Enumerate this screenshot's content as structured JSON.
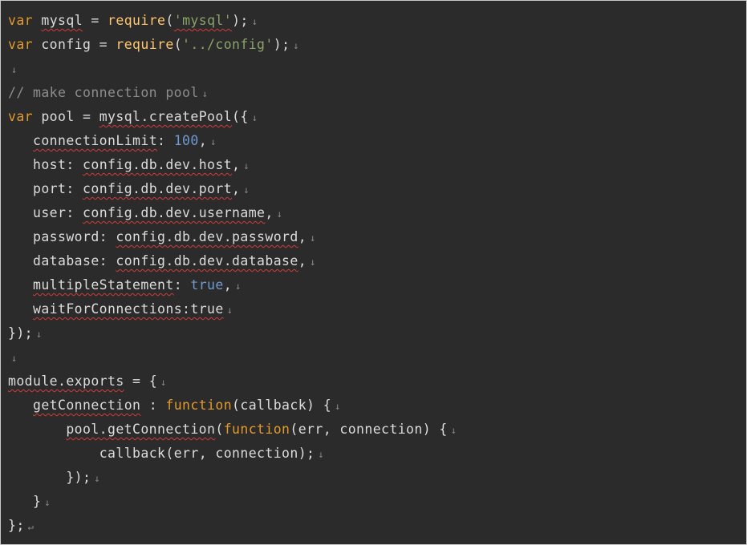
{
  "editor": {
    "colors": {
      "background": "#2b2b2b",
      "text": "#dcdcdc",
      "keyword": "#e39a2d",
      "string": "#8ba36a",
      "number": "#6f9bd1",
      "comment": "#8c8c8c",
      "function_call": "#ffc66d",
      "spellcheck_underline": "#d23b3b",
      "eol_marker": "#8a8a8a"
    },
    "lines": [
      {
        "indent": 0,
        "eol": "↓",
        "tokens": [
          {
            "t": "var",
            "c": "keyword"
          },
          {
            "t": " "
          },
          {
            "t": "mysql",
            "c": "ident",
            "u": true
          },
          {
            "t": " = "
          },
          {
            "t": "require",
            "c": "call"
          },
          {
            "t": "("
          },
          {
            "t": "'mysql'",
            "c": "string",
            "u": true
          },
          {
            "t": ");"
          }
        ]
      },
      {
        "indent": 0,
        "eol": "↓",
        "tokens": [
          {
            "t": "var",
            "c": "keyword"
          },
          {
            "t": " config = "
          },
          {
            "t": "require",
            "c": "call"
          },
          {
            "t": "("
          },
          {
            "t": "'../config'",
            "c": "string"
          },
          {
            "t": ");"
          }
        ]
      },
      {
        "indent": 0,
        "eol": "↓",
        "tokens": []
      },
      {
        "indent": 0,
        "eol": "↓",
        "tokens": [
          {
            "t": "// make connection pool",
            "c": "comment"
          }
        ]
      },
      {
        "indent": 0,
        "eol": "↓",
        "tokens": [
          {
            "t": "var",
            "c": "keyword"
          },
          {
            "t": " pool = "
          },
          {
            "t": "mysql.createPool",
            "c": "ident",
            "u": true
          },
          {
            "t": "({"
          }
        ]
      },
      {
        "indent": 3,
        "eol": "↓",
        "tokens": [
          {
            "t": "connectionLimit",
            "c": "ident",
            "u": true
          },
          {
            "t": ": "
          },
          {
            "t": "100",
            "c": "number"
          },
          {
            "t": ","
          }
        ]
      },
      {
        "indent": 3,
        "eol": "↓",
        "tokens": [
          {
            "t": "host: "
          },
          {
            "t": "config.db.dev.host",
            "c": "ident",
            "u": true
          },
          {
            "t": ","
          }
        ]
      },
      {
        "indent": 3,
        "eol": "↓",
        "tokens": [
          {
            "t": "port: "
          },
          {
            "t": "config.db.dev.port",
            "c": "ident",
            "u": true
          },
          {
            "t": ","
          }
        ]
      },
      {
        "indent": 3,
        "eol": "↓",
        "tokens": [
          {
            "t": "user: "
          },
          {
            "t": "config.db.dev.username",
            "c": "ident",
            "u": true
          },
          {
            "t": ","
          }
        ]
      },
      {
        "indent": 3,
        "eol": "↓",
        "tokens": [
          {
            "t": "password: "
          },
          {
            "t": "config.db.dev.password",
            "c": "ident",
            "u": true
          },
          {
            "t": ","
          }
        ]
      },
      {
        "indent": 3,
        "eol": "↓",
        "tokens": [
          {
            "t": "database: "
          },
          {
            "t": "config.db.dev.database",
            "c": "ident",
            "u": true
          },
          {
            "t": ","
          }
        ]
      },
      {
        "indent": 3,
        "eol": "↓",
        "tokens": [
          {
            "t": "multipleStatement",
            "c": "ident",
            "u": true
          },
          {
            "t": ": "
          },
          {
            "t": "true",
            "c": "bool"
          },
          {
            "t": ","
          }
        ]
      },
      {
        "indent": 3,
        "eol": "↓",
        "tokens": [
          {
            "t": "waitForConnections:true",
            "c": "ident",
            "u": true
          }
        ]
      },
      {
        "indent": 0,
        "eol": "↓",
        "tokens": [
          {
            "t": "});"
          }
        ]
      },
      {
        "indent": 0,
        "eol": "↓",
        "tokens": []
      },
      {
        "indent": 0,
        "eol": "↓",
        "tokens": [
          {
            "t": "module.exports",
            "c": "ident",
            "u": true
          },
          {
            "t": " = {"
          }
        ]
      },
      {
        "indent": 3,
        "eol": "↓",
        "tokens": [
          {
            "t": "getConnection",
            "c": "ident",
            "u": true
          },
          {
            "t": " : "
          },
          {
            "t": "function",
            "c": "keyword"
          },
          {
            "t": "(callback) {"
          }
        ]
      },
      {
        "indent": 7,
        "eol": "↓",
        "tokens": [
          {
            "t": "pool.getConnection",
            "c": "ident",
            "u": true
          },
          {
            "t": "("
          },
          {
            "t": "function",
            "c": "keyword"
          },
          {
            "t": "(err, connection) {"
          }
        ]
      },
      {
        "indent": 11,
        "eol": "↓",
        "tokens": [
          {
            "t": "callback(err, connection);"
          }
        ]
      },
      {
        "indent": 7,
        "eol": "↓",
        "tokens": [
          {
            "t": "});"
          }
        ]
      },
      {
        "indent": 3,
        "eol": "↓",
        "tokens": [
          {
            "t": "}"
          }
        ]
      },
      {
        "indent": 0,
        "eol": "↵",
        "tokens": [
          {
            "t": "};"
          }
        ]
      }
    ]
  }
}
